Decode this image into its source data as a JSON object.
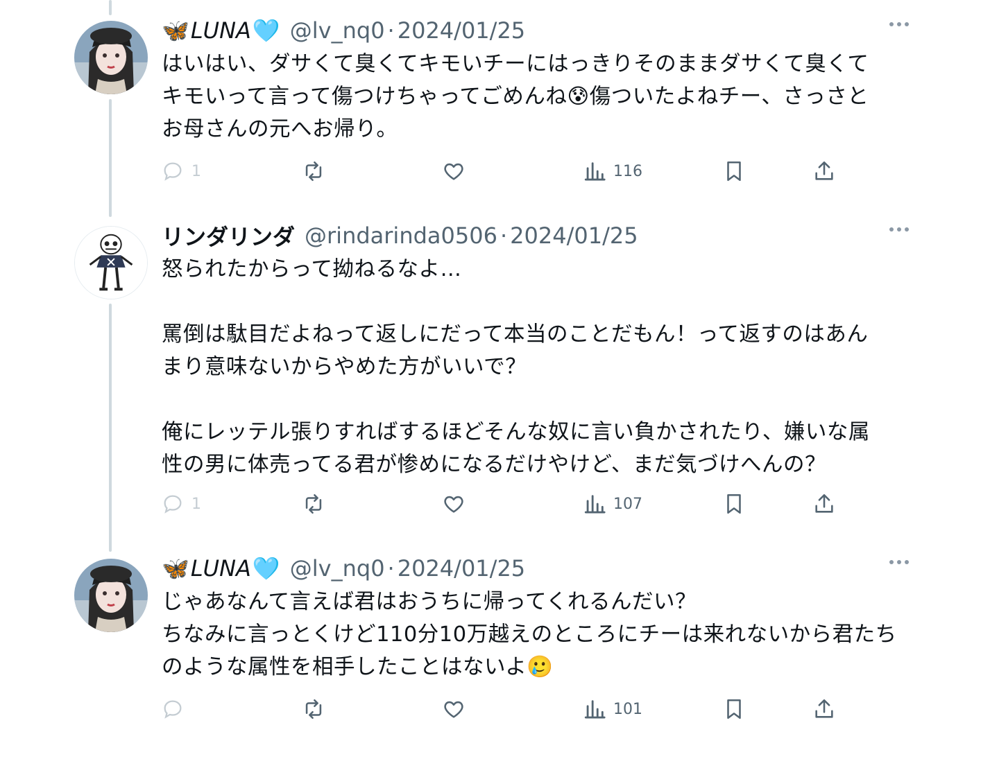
{
  "tweets": [
    {
      "name_prefix": "🦋",
      "name": "LUNA",
      "name_suffix": "🩵",
      "handle": "@lv_nq0",
      "separator": "·",
      "date": "2024/01/25",
      "text": "はいはい、ダサくて臭くてキモいチーにはっきりそのままダサくて臭くて\nキモいって言って傷つけちゃってごめんね😰傷ついたよねチー、さっさと\nお母さんの元へお帰り。",
      "reply_count": "1",
      "views": "116"
    },
    {
      "name_prefix": "",
      "name": "リンダリンダ",
      "name_suffix": "",
      "handle": "@rindarinda0506",
      "separator": "·",
      "date": "2024/01/25",
      "text": "怒られたからって拗ねるなよ…\n\n罵倒は駄目だよねって返しにだって本当のことだもん！って返すのはあん\nまり意味ないからやめた方がいいで？\n\n俺にレッテル張りすればするほどそんな奴に言い負かされたり、嫌いな属\n性の男に体売ってる君が惨めになるだけやけど、まだ気づけへんの？",
      "reply_count": "1",
      "views": "107"
    },
    {
      "name_prefix": "🦋",
      "name": "LUNA",
      "name_suffix": "🩵",
      "handle": "@lv_nq0",
      "separator": "·",
      "date": "2024/01/25",
      "text": "じゃあなんて言えば君はおうちに帰ってくれるんだい？\nちなみに言っとくけど110分10万越えのところにチーは来れないから君たち\nのような属性を相手したことはないよ🥲",
      "reply_count": "",
      "views": "101"
    }
  ],
  "icons": {
    "reply": "reply-icon",
    "retweet": "retweet-icon",
    "like": "heart-icon",
    "views": "views-icon",
    "bookmark": "bookmark-icon",
    "share": "share-icon",
    "more": "more-icon"
  },
  "colors": {
    "text": "#0f1419",
    "secondary": "#536471",
    "thread_line": "#cfd9de",
    "background": "#ffffff"
  }
}
